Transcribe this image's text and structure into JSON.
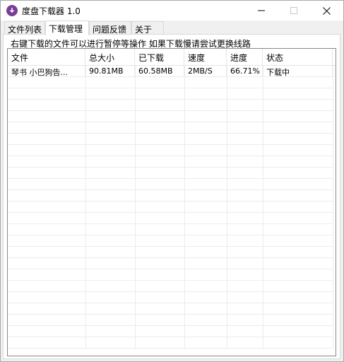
{
  "window": {
    "title": "度盘下载器 1.0",
    "app_icon": "download-arrow-icon",
    "controls": [
      "minimize-icon",
      "maximize-icon",
      "close-icon"
    ]
  },
  "tabs": [
    {
      "label": "文件列表",
      "active": false
    },
    {
      "label": "下载管理",
      "active": true
    },
    {
      "label": "问题反馈",
      "active": false
    },
    {
      "label": "关于",
      "active": false
    }
  ],
  "notice": "右键下载的文件可以进行暂停等操作 如果下载慢请尝试更换线路",
  "table": {
    "columns": [
      "文件",
      "总大小",
      "已下载",
      "速度",
      "进度",
      "状态"
    ],
    "rows": [
      {
        "file": "琴书 小巴狗告...",
        "total": "90.81MB",
        "downloaded": "60.58MB",
        "speed": "2MB/S",
        "progress": "66.71%",
        "status": "下载中"
      }
    ]
  },
  "colors": {
    "app_icon": "#7a3e96",
    "grid": "#ececec",
    "border": "#828790"
  }
}
